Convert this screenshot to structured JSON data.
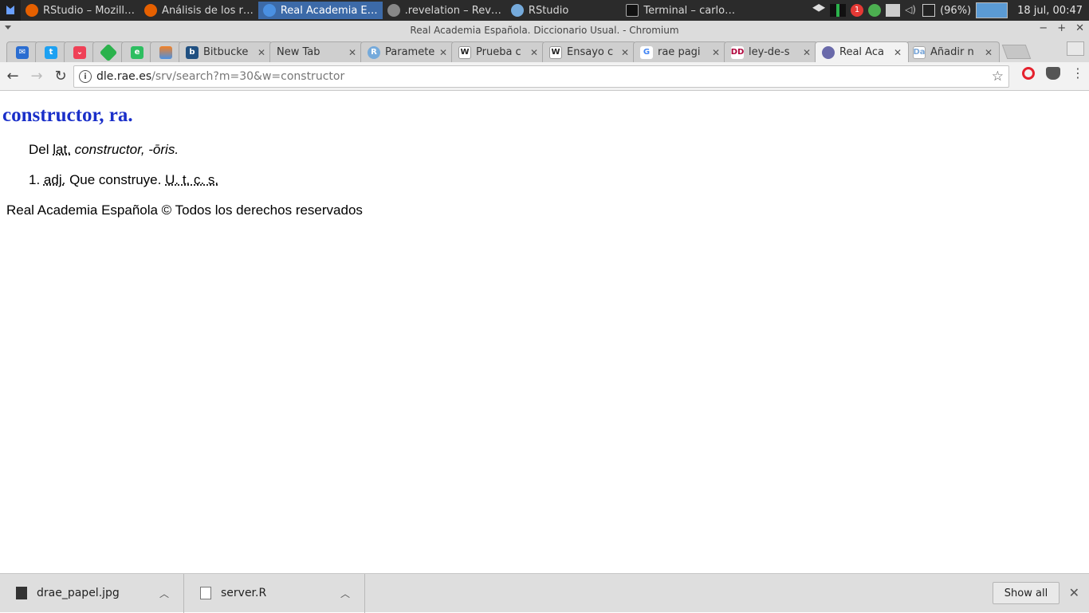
{
  "taskbar": {
    "tasks": [
      {
        "label": "RStudio – Mozill…",
        "icon_color": "#e66000",
        "active": false
      },
      {
        "label": "Análisis de los r…",
        "icon_color": "#e66000",
        "active": false
      },
      {
        "label": "Real Academia E…",
        "icon_color": "#4a90e2",
        "active": true
      },
      {
        "label": ".revelation – Rev…",
        "icon_color": "#888888",
        "active": false
      },
      {
        "label": "RStudio",
        "icon_color": "#75aadb",
        "active": false
      },
      {
        "label": "Terminal – carlo…",
        "icon_color": "#111111",
        "active": false
      }
    ],
    "battery": "(96%)",
    "notification_count": "1",
    "clock": "18 jul, 00:47"
  },
  "window": {
    "title": "Real Academia Española. Diccionario Usual. - Chromium"
  },
  "tabs": [
    {
      "label": "",
      "icon": "mail-icon",
      "color": "#2a6dd1",
      "pinned": true
    },
    {
      "label": "",
      "icon": "twitter-icon",
      "color": "#1da1f2",
      "pinned": true
    },
    {
      "label": "",
      "icon": "pocket-icon",
      "color": "#ef4056",
      "pinned": true
    },
    {
      "label": "",
      "icon": "feedly-icon",
      "color": "#2bb24c",
      "pinned": true
    },
    {
      "label": "",
      "icon": "evernote-icon",
      "color": "#2dbe60",
      "pinned": true
    },
    {
      "label": "",
      "icon": "stack-icon",
      "color": "#f48024",
      "pinned": true
    },
    {
      "label": "Bitbucke",
      "icon": "bitbucket-icon",
      "color": "#205081",
      "pinned": false
    },
    {
      "label": "New Tab",
      "icon": "",
      "color": "",
      "pinned": false
    },
    {
      "label": "Paramete",
      "icon": "r-icon",
      "color": "#75aadb",
      "pinned": false
    },
    {
      "label": "Prueba c",
      "icon": "wikipedia-icon",
      "color": "#222222",
      "pinned": false
    },
    {
      "label": "Ensayo c",
      "icon": "wikipedia-icon",
      "color": "#222222",
      "pinned": false
    },
    {
      "label": "rae pagi",
      "icon": "google-icon",
      "color": "#4285f4",
      "pinned": false
    },
    {
      "label": "ley-de-s",
      "icon": "dd-icon",
      "color": "#b0003a",
      "pinned": false
    },
    {
      "label": "Real Aca",
      "icon": "rae-icon",
      "color": "#6a6aaa",
      "pinned": false,
      "active": true
    },
    {
      "label": "Añadir n",
      "icon": "doc-icon",
      "color": "#7aa7d9",
      "pinned": false
    }
  ],
  "toolbar": {
    "url_host": "dle.rae.es",
    "url_path": "/srv/search?m=30&w=constructor"
  },
  "entry": {
    "headword": "constructor, ra.",
    "etym_prefix": "Del",
    "etym_abbr": "lat.",
    "etym_form": "constructor, -ōris.",
    "def_number": "1.",
    "def_abbr": "adj.",
    "def_text": "Que construye.",
    "def_usage": "U. t. c. s.",
    "copyright": "Real Academia Española © Todos los derechos reservados"
  },
  "downloads": {
    "items": [
      {
        "filename": "drae_papel.jpg"
      },
      {
        "filename": "server.R"
      }
    ],
    "show_all": "Show all"
  }
}
